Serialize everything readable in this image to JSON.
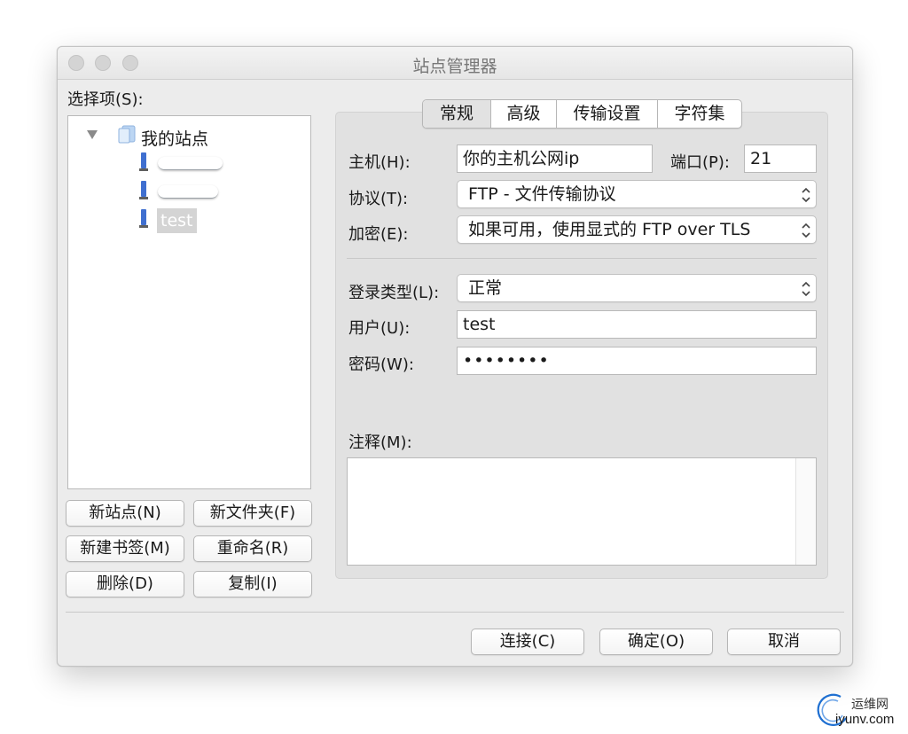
{
  "window": {
    "title": "站点管理器"
  },
  "left": {
    "section_label": "选择项(S):",
    "tree": {
      "root_label": "我的站点",
      "sites": [
        "test"
      ]
    },
    "buttons": {
      "new_site": "新站点(N)",
      "new_folder": "新文件夹(F)",
      "new_bookmark": "新建书签(M)",
      "rename": "重命名(R)",
      "delete": "删除(D)",
      "copy": "复制(I)"
    }
  },
  "tabs": [
    "常规",
    "高级",
    "传输设置",
    "字符集"
  ],
  "general": {
    "host_label": "主机(H):",
    "host_value": "你的主机公网ip",
    "port_label": "端口(P):",
    "port_value": "21",
    "protocol_label": "协议(T):",
    "protocol_value": "FTP - 文件传输协议",
    "encryption_label": "加密(E):",
    "encryption_value": "如果可用，使用显式的 FTP over TLS",
    "logon_type_label": "登录类型(L):",
    "logon_type_value": "正常",
    "user_label": "用户(U):",
    "user_value": "test",
    "password_label": "密码(W):",
    "password_value": "••••••••",
    "comments_label": "注释(M):"
  },
  "footer": {
    "connect": "连接(C)",
    "ok": "确定(O)",
    "cancel": "取消"
  },
  "watermark": {
    "line1": "运维网",
    "line2": "iyunv.com"
  },
  "colors": {
    "window_bg": "#ececec",
    "selection_bg": "#d4d4d4",
    "watermark_blue": "#1e6fd1"
  }
}
